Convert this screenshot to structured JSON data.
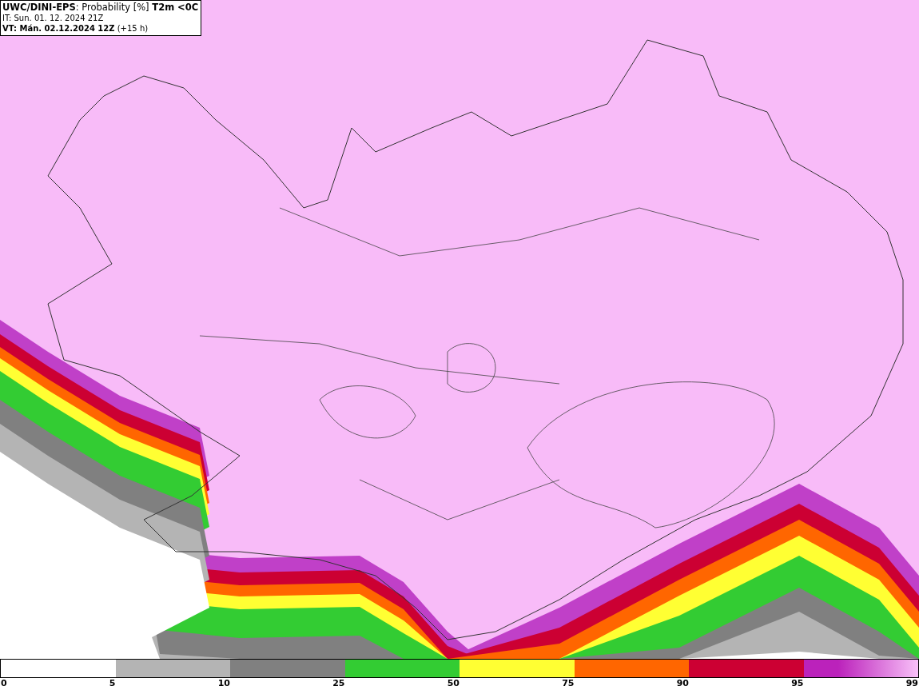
{
  "header": {
    "lines": [
      "**UWC/DINI-EPS**: Probability [%] **T2m <0C**",
      "IT: Sun. 01. 12. 2024 21Z",
      "**VT: Mán. 02.12.2024 12Z** (+15 h)"
    ]
  },
  "legend": {
    "segments": [
      {
        "color": "#b4b4b4"
      },
      {
        "color": "#808080"
      },
      {
        "color": "#33cc33"
      },
      {
        "color": "#ffff33"
      },
      {
        "color": "#ff6600"
      },
      {
        "color": "#cc0033"
      },
      {
        "color": "#bb22bb"
      }
    ],
    "labels": [
      "0",
      "5",
      "10",
      "25",
      "50",
      "75",
      "90",
      "95",
      "99"
    ]
  }
}
